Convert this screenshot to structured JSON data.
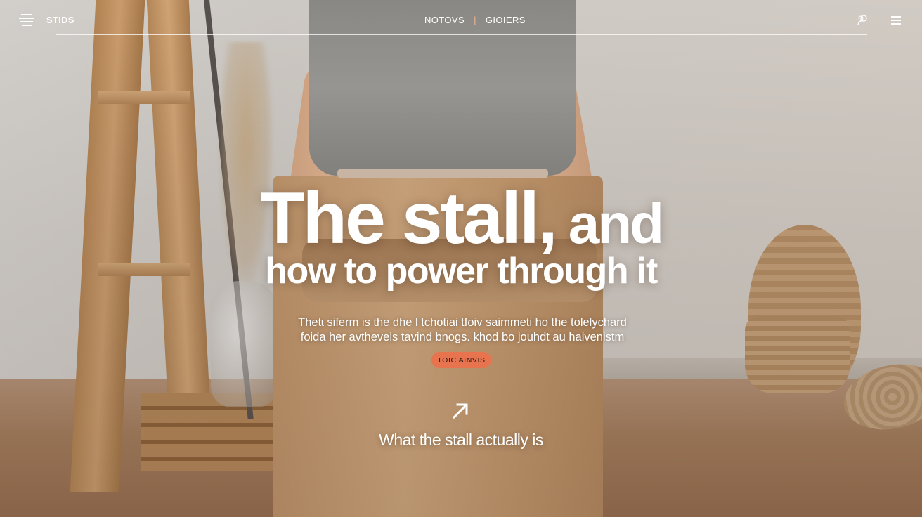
{
  "header": {
    "brand": "STIDS",
    "nav_items": [
      "NOTOVS",
      "GIOIERS"
    ],
    "nav_separator": "|",
    "icons": {
      "left_menu": "menu-lines-icon",
      "user": "user-icon",
      "right_menu": "hamburger-icon"
    }
  },
  "hero": {
    "title_line1_main": "The stall,",
    "title_line1_tail": "and",
    "title_line2": "how to power through it",
    "body": "Thetɩ siferm is the dhe l tchotiai tfoiv saimmeti ho the tolelychard foida her avthevels tavind bnogs. khod bo jouhdt au haivenistm",
    "cta_label": "TOIC AINVIS",
    "arrow_icon": "arrow-up-right-icon",
    "section_link": "What the stall actually is"
  },
  "colors": {
    "accent": "#e8744f",
    "text": "#ffffff",
    "separator": "#f0b48e"
  }
}
